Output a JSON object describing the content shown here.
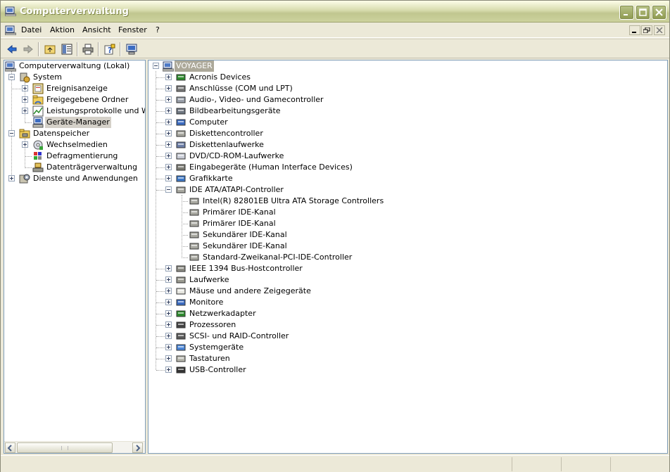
{
  "window": {
    "title": "Computerverwaltung"
  },
  "menu": {
    "items": [
      "Datei",
      "Aktion",
      "Ansicht",
      "Fenster",
      "?"
    ]
  },
  "left_tree": [
    {
      "label": "Computerverwaltung (Lokal)",
      "icon": "computer-management-icon"
    },
    {
      "label": "System",
      "icon": "system-tools-icon"
    },
    {
      "label": "Ereignisanzeige",
      "icon": "event-viewer-icon"
    },
    {
      "label": "Freigegebene Ordner",
      "icon": "shared-folder-icon"
    },
    {
      "label": "Leistungsprotokolle und Warn",
      "icon": "performance-logs-icon"
    },
    {
      "label": "Geräte-Manager",
      "icon": "device-manager-icon"
    },
    {
      "label": "Datenspeicher",
      "icon": "storage-icon"
    },
    {
      "label": "Wechselmedien",
      "icon": "removable-media-icon"
    },
    {
      "label": "Defragmentierung",
      "icon": "defrag-icon"
    },
    {
      "label": "Datenträgerverwaltung",
      "icon": "disk-management-icon"
    },
    {
      "label": "Dienste und Anwendungen",
      "icon": "services-icon"
    }
  ],
  "device_tree": {
    "root": "VOYAGER",
    "categories": [
      {
        "label": "Acronis Devices",
        "icon": "board-icon"
      },
      {
        "label": "Anschlüsse (COM und LPT)",
        "icon": "port-icon"
      },
      {
        "label": "Audio-, Video- und Gamecontroller",
        "icon": "sound-icon"
      },
      {
        "label": "Bildbearbeitungsgeräte",
        "icon": "camera-icon"
      },
      {
        "label": "Computer",
        "icon": "computer-icon"
      },
      {
        "label": "Diskettencontroller",
        "icon": "controller-icon"
      },
      {
        "label": "Diskettenlaufwerke",
        "icon": "floppy-icon"
      },
      {
        "label": "DVD/CD-ROM-Laufwerke",
        "icon": "cdrom-icon"
      },
      {
        "label": "Eingabegeräte (Human Interface Devices)",
        "icon": "hid-icon"
      },
      {
        "label": "Grafikkarte",
        "icon": "display-icon"
      },
      {
        "label": "IDE ATA/ATAPI-Controller",
        "icon": "controller-icon"
      },
      {
        "label": "Intel(R) 82801EB Ultra ATA Storage Controllers",
        "icon": "controller-icon"
      },
      {
        "label": "Primärer IDE-Kanal",
        "icon": "controller-icon"
      },
      {
        "label": "Primärer IDE-Kanal",
        "icon": "controller-icon"
      },
      {
        "label": "Sekundärer IDE-Kanal",
        "icon": "controller-icon"
      },
      {
        "label": "Sekundärer IDE-Kanal",
        "icon": "controller-icon"
      },
      {
        "label": "Standard-Zweikanal-PCI-IDE-Controller",
        "icon": "controller-icon"
      },
      {
        "label": "IEEE 1394 Bus-Hostcontroller",
        "icon": "firewire-icon"
      },
      {
        "label": "Laufwerke",
        "icon": "disk-drive-icon"
      },
      {
        "label": "Mäuse und andere Zeigegeräte",
        "icon": "mouse-icon"
      },
      {
        "label": "Monitore",
        "icon": "monitor-icon"
      },
      {
        "label": "Netzwerkadapter",
        "icon": "network-icon"
      },
      {
        "label": "Prozessoren",
        "icon": "processor-icon"
      },
      {
        "label": "SCSI- und RAID-Controller",
        "icon": "scsi-icon"
      },
      {
        "label": "Systemgeräte",
        "icon": "system-devices-icon"
      },
      {
        "label": "Tastaturen",
        "icon": "keyboard-icon"
      },
      {
        "label": "USB-Controller",
        "icon": "usb-icon"
      }
    ]
  }
}
